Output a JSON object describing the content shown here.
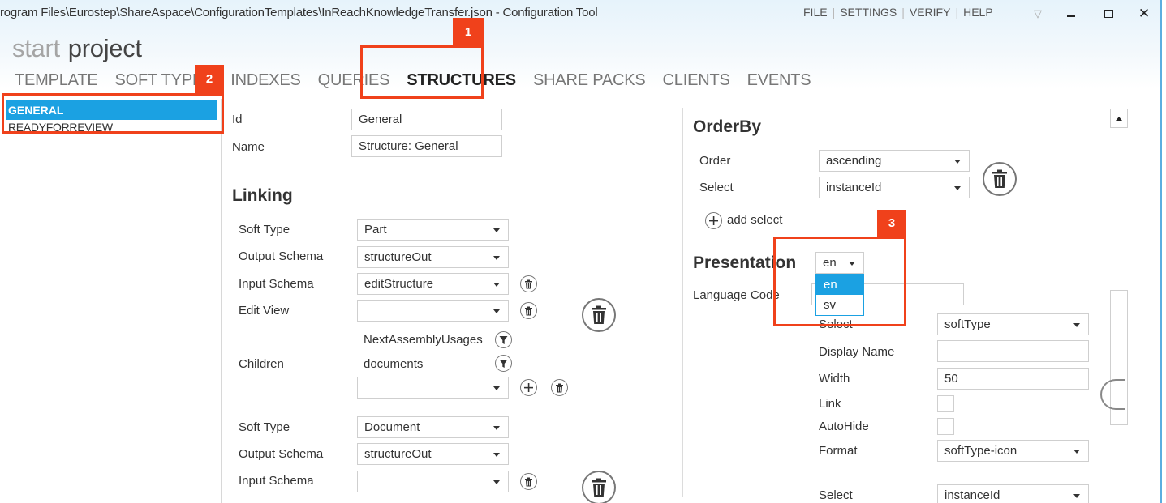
{
  "window": {
    "title": "rogram Files\\Eurostep\\ShareAspace\\ConfigurationTemplates\\InReachKnowledgeTransfer.json - Configuration Tool",
    "menu": [
      "FILE",
      "SETTINGS",
      "VERIFY",
      "HELP"
    ],
    "controls": {
      "pin": "pin-icon",
      "minimize": "minimize-icon",
      "maximize": "maximize-icon",
      "close": "close-icon"
    }
  },
  "breadcrumb": {
    "start": "start",
    "project": "project"
  },
  "tabs": [
    {
      "label": "TEMPLATE",
      "active": false
    },
    {
      "label": "SOFT TYPES",
      "active": false
    },
    {
      "label": "INDEXES",
      "active": false
    },
    {
      "label": "QUERIES",
      "active": false
    },
    {
      "label": "STRUCTURES",
      "active": true
    },
    {
      "label": "SHARE PACKS",
      "active": false
    },
    {
      "label": "CLIENTS",
      "active": false
    },
    {
      "label": "EVENTS",
      "active": false
    }
  ],
  "sidebar": {
    "items": [
      {
        "label": "GENERAL",
        "selected": true
      },
      {
        "label": "READYFORREVIEW",
        "selected": false
      }
    ]
  },
  "general": {
    "id_label": "Id",
    "id_value": "General",
    "name_label": "Name",
    "name_value": "Structure: General"
  },
  "linking": {
    "heading": "Linking",
    "blocks": [
      {
        "soft_type_label": "Soft Type",
        "soft_type": "Part",
        "output_schema_label": "Output Schema",
        "output_schema": "structureOut",
        "input_schema_label": "Input Schema",
        "input_schema": "editStructure",
        "edit_view_label": "Edit View",
        "edit_view": "",
        "children_label": "Children",
        "children": [
          "NextAssemblyUsages",
          "documents"
        ],
        "children_new": ""
      },
      {
        "soft_type_label": "Soft Type",
        "soft_type": "Document",
        "output_schema_label": "Output Schema",
        "output_schema": "structureOut",
        "input_schema_label": "Input Schema",
        "input_schema": ""
      }
    ]
  },
  "orderby": {
    "heading": "OrderBy",
    "order_label": "Order",
    "order": "ascending",
    "select_label": "Select",
    "select": "instanceId",
    "add_select": "add select"
  },
  "presentation": {
    "heading": "Presentation",
    "language": "en",
    "language_options": [
      "en",
      "sv"
    ],
    "language_highlighted": "en",
    "language_code_label": "Language Code",
    "language_code_value": "",
    "columns": [
      {
        "select_label": "Select",
        "select": "softType",
        "display_name_label": "Display Name",
        "display_name": "",
        "width_label": "Width",
        "width": "50",
        "link_label": "Link",
        "link": false,
        "autohide_label": "AutoHide",
        "autohide": false,
        "format_label": "Format",
        "format": "softType-icon"
      },
      {
        "select_label": "Select",
        "select": "instanceId"
      }
    ]
  },
  "callouts": [
    "1",
    "2",
    "3"
  ],
  "colors": {
    "accent": "#1ba1e2",
    "callout": "#f0411b",
    "window_border": "#5aaee0"
  }
}
